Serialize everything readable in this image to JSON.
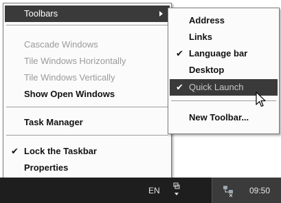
{
  "context_menu": {
    "toolbars_label": "Toolbars",
    "cascade_label": "Cascade Windows",
    "tile_horizontal_label": "Tile Windows Horizontally",
    "tile_vertical_label": "Tile Windows Vertically",
    "show_open_label": "Show Open Windows",
    "task_manager_label": "Task Manager",
    "lock_taskbar_label": "Lock the Taskbar",
    "lock_taskbar_checked": true,
    "properties_label": "Properties"
  },
  "toolbars_submenu": {
    "address_label": "Address",
    "links_label": "Links",
    "language_bar_label": "Language bar",
    "language_bar_checked": true,
    "desktop_label": "Desktop",
    "quick_launch_label": "Quick Launch",
    "quick_launch_checked": true,
    "new_toolbar_label": "New Toolbar..."
  },
  "taskbar": {
    "language_code": "EN",
    "clock": "09:50"
  },
  "checkmark_glyph": "✔",
  "colors": {
    "highlight": "#3a3a3a",
    "taskbar": "#1e1e1e",
    "disabled_text": "#9a9a9a"
  },
  "icons": [
    "submenu-arrow-icon",
    "checkmark-icon",
    "language-options-icon",
    "tray-network-icon",
    "mouse-cursor-icon"
  ]
}
